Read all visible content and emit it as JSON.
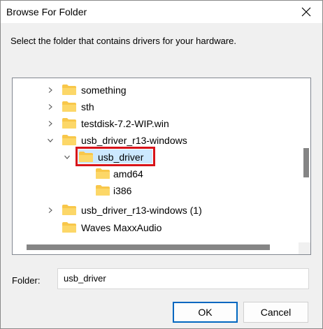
{
  "window": {
    "title": "Browse For Folder",
    "close_icon": "close-icon"
  },
  "instruction": "Select the folder that contains drivers for your hardware.",
  "tree": {
    "items": [
      {
        "label": "something",
        "expand": "collapsed",
        "level": 0
      },
      {
        "label": "sth",
        "expand": "collapsed",
        "level": 0
      },
      {
        "label": "testdisk-7.2-WIP.win",
        "expand": "collapsed",
        "level": 0
      },
      {
        "label": "usb_driver_r13-windows",
        "expand": "expanded",
        "level": 0
      },
      {
        "label": "usb_driver",
        "expand": "expanded",
        "level": 1,
        "selected": true
      },
      {
        "label": "amd64",
        "expand": "none",
        "level": 2
      },
      {
        "label": "i386",
        "expand": "none",
        "level": 2
      },
      {
        "label": "usb_driver_r13-windows (1)",
        "expand": "collapsed",
        "level": 0
      },
      {
        "label": "Waves MaxxAudio",
        "expand": "none",
        "level": 0
      }
    ],
    "selection_highlight_color": "#d7141a",
    "folder_color": "#f8c74a"
  },
  "folder_field": {
    "label": "Folder:",
    "value": "usb_driver"
  },
  "buttons": {
    "ok": "OK",
    "cancel": "Cancel"
  }
}
